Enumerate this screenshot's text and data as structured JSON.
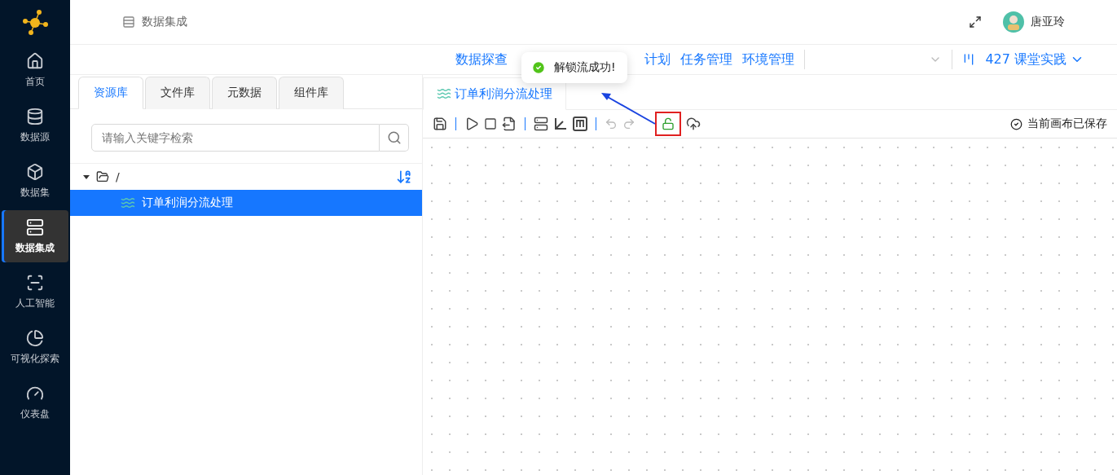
{
  "sidebar": {
    "items": [
      {
        "label": "首页",
        "selected": false
      },
      {
        "label": "数据源",
        "selected": false
      },
      {
        "label": "数据集",
        "selected": false
      },
      {
        "label": "数据集成",
        "selected": true
      },
      {
        "label": "人工智能",
        "selected": false
      },
      {
        "label": "可视化探索",
        "selected": false
      },
      {
        "label": "仪表盘",
        "selected": false
      }
    ]
  },
  "header": {
    "breadcrumb": "数据集成",
    "user": "唐亚玲"
  },
  "nav": {
    "items": [
      "数据探查",
      "计划",
      "任务管理",
      "环境管理"
    ],
    "project": "427 课堂实践"
  },
  "left_panel": {
    "tabs": [
      {
        "label": "资源库",
        "selected": true
      },
      {
        "label": "文件库",
        "selected": false
      },
      {
        "label": "元数据",
        "selected": false
      },
      {
        "label": "组件库",
        "selected": false
      }
    ],
    "search": {
      "placeholder": "请输入关键字检索"
    },
    "tree": [
      {
        "label": "/",
        "expanded": true,
        "children": [
          {
            "label": "订单利润分流处理",
            "selected": true
          }
        ]
      }
    ]
  },
  "editor": {
    "tab": "订单利润分流处理",
    "status": "当前画布已保存"
  },
  "toast": {
    "message": "解锁流成功!"
  }
}
